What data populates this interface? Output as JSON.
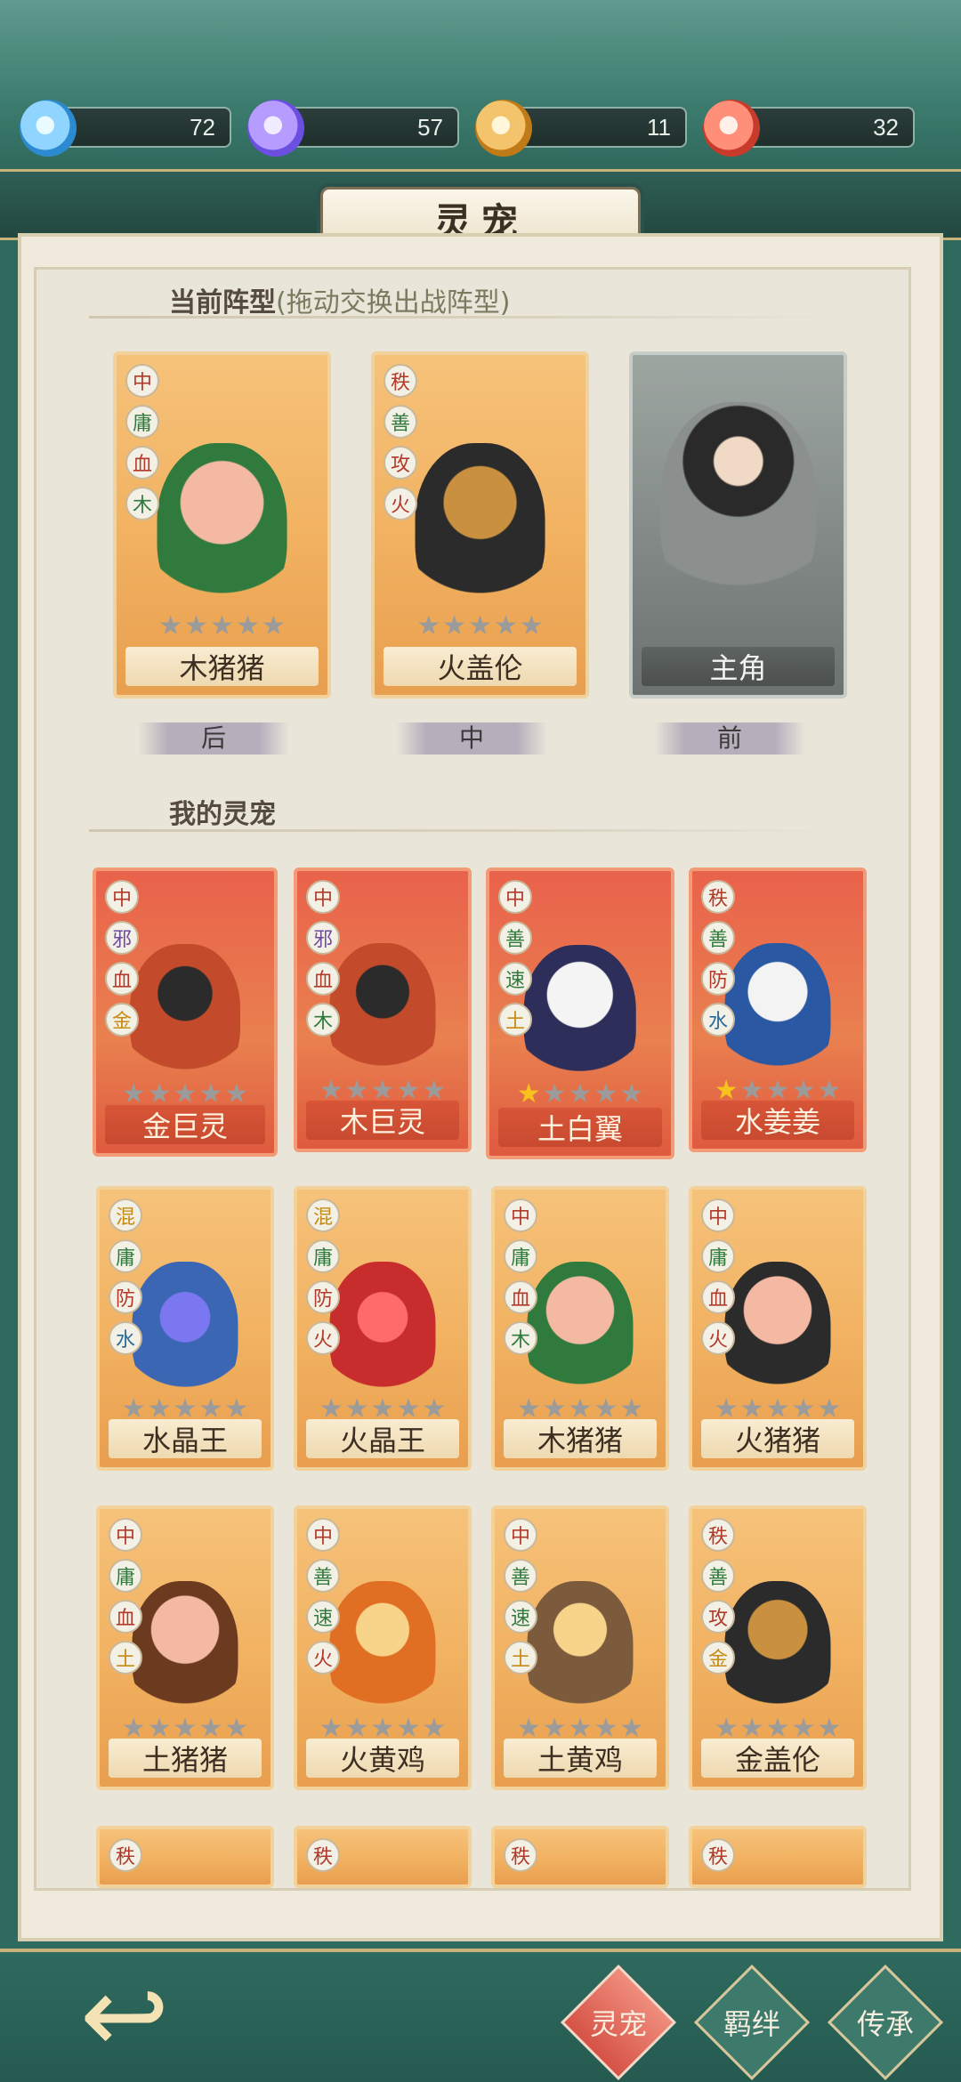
{
  "resources": [
    {
      "icon": "blue-spirit-icon",
      "value": "72",
      "color": "#8fd5ff"
    },
    {
      "icon": "purple-spirit-icon",
      "value": "57",
      "color": "#b69cff"
    },
    {
      "icon": "gold-spirit-icon",
      "value": "11",
      "color": "#f3c46b"
    },
    {
      "icon": "red-spirit-icon",
      "value": "32",
      "color": "#ff8f78"
    }
  ],
  "header": {
    "title": "灵宠"
  },
  "formation": {
    "title": "当前阵型",
    "subtitle": "(拖动交换出战阵型)",
    "cards": [
      {
        "name": "木猪猪",
        "tags": [
          "中",
          "庸",
          "血",
          "木"
        ],
        "stars": 0,
        "style": "gold"
      },
      {
        "name": "火盖伦",
        "tags": [
          "秩",
          "善",
          "攻",
          "火"
        ],
        "stars": 0,
        "style": "gold"
      },
      {
        "name": "主角",
        "tags": [],
        "stars": 0,
        "style": "hero"
      }
    ],
    "positions": [
      "后",
      "中",
      "前"
    ]
  },
  "my_pets": {
    "title": "我的灵宠",
    "cards": [
      {
        "name": "金巨灵",
        "tags": [
          "中",
          "邪",
          "血",
          "金"
        ],
        "stars": 0,
        "style": "red"
      },
      {
        "name": "木巨灵",
        "tags": [
          "中",
          "邪",
          "血",
          "木"
        ],
        "stars": 0,
        "style": "red"
      },
      {
        "name": "土白翼",
        "tags": [
          "中",
          "善",
          "速",
          "土"
        ],
        "stars": 1,
        "style": "red"
      },
      {
        "name": "水姜姜",
        "tags": [
          "秩",
          "善",
          "防",
          "水"
        ],
        "stars": 1,
        "style": "red"
      },
      {
        "name": "水晶王",
        "tags": [
          "混",
          "庸",
          "防",
          "水"
        ],
        "stars": 0,
        "style": "gold"
      },
      {
        "name": "火晶王",
        "tags": [
          "混",
          "庸",
          "防",
          "火"
        ],
        "stars": 0,
        "style": "gold"
      },
      {
        "name": "木猪猪",
        "tags": [
          "中",
          "庸",
          "血",
          "木"
        ],
        "stars": 0,
        "style": "gold"
      },
      {
        "name": "火猪猪",
        "tags": [
          "中",
          "庸",
          "血",
          "火"
        ],
        "stars": 0,
        "style": "gold"
      },
      {
        "name": "土猪猪",
        "tags": [
          "中",
          "庸",
          "血",
          "土"
        ],
        "stars": 0,
        "style": "gold"
      },
      {
        "name": "火黄鸡",
        "tags": [
          "中",
          "善",
          "速",
          "火"
        ],
        "stars": 0,
        "style": "gold"
      },
      {
        "name": "土黄鸡",
        "tags": [
          "中",
          "善",
          "速",
          "土"
        ],
        "stars": 0,
        "style": "gold"
      },
      {
        "name": "金盖伦",
        "tags": [
          "秩",
          "善",
          "攻",
          "金"
        ],
        "stars": 0,
        "style": "gold"
      },
      {
        "name": "",
        "tags": [
          "秩"
        ],
        "stars": 0,
        "style": "gold"
      },
      {
        "name": "",
        "tags": [
          "秩"
        ],
        "stars": 0,
        "style": "gold"
      },
      {
        "name": "",
        "tags": [
          "秩"
        ],
        "stars": 0,
        "style": "gold"
      },
      {
        "name": "",
        "tags": [
          "秩"
        ],
        "stars": 0,
        "style": "gold"
      }
    ]
  },
  "bottom_nav": {
    "back_label": "↩",
    "tabs": [
      {
        "label": "灵宠",
        "active": true
      },
      {
        "label": "羁绊",
        "active": false
      },
      {
        "label": "传承",
        "active": false
      }
    ]
  }
}
